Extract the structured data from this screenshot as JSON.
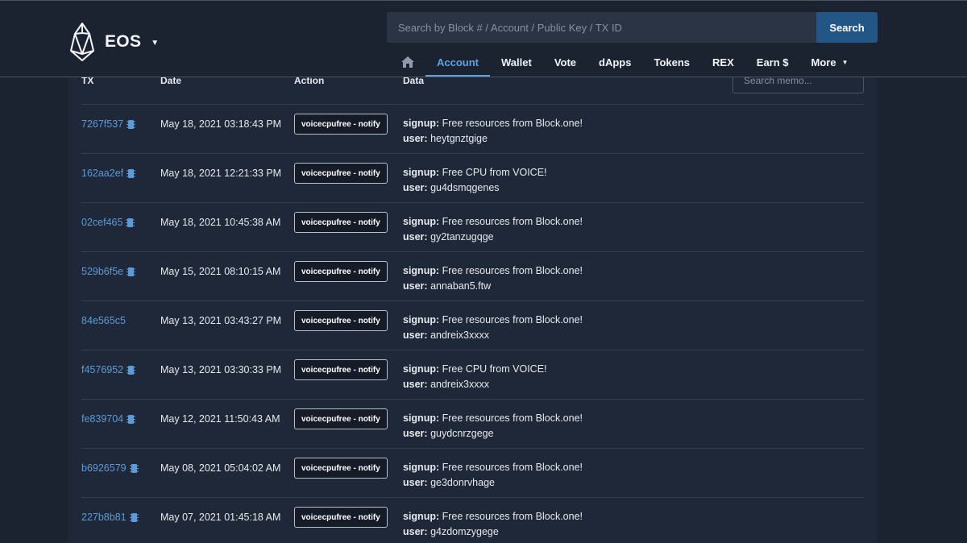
{
  "header": {
    "brand": "EOS",
    "search_placeholder": "Search by Block # / Account / Public Key / TX ID",
    "search_button": "Search",
    "nav": [
      {
        "label": "Account",
        "active": true
      },
      {
        "label": "Wallet"
      },
      {
        "label": "Vote"
      },
      {
        "label": "dApps"
      },
      {
        "label": "Tokens"
      },
      {
        "label": "REX"
      },
      {
        "label": "Earn $"
      },
      {
        "label": "More"
      }
    ]
  },
  "table": {
    "columns": {
      "tx": "TX",
      "date": "Date",
      "action": "Action",
      "data": "Data"
    },
    "memo_placeholder": "Search memo...",
    "rows": [
      {
        "tx": "7267f537",
        "chip": true,
        "date": "May 18, 2021 03:18:43 PM",
        "action": "voicecpufree - notify",
        "signup_key": "signup:",
        "signup": "Free resources from Block.one!",
        "user_key": "user:",
        "user": "heytgnztgige"
      },
      {
        "tx": "162aa2ef",
        "chip": true,
        "date": "May 18, 2021 12:21:33 PM",
        "action": "voicecpufree - notify",
        "signup_key": "signup:",
        "signup": "Free CPU from VOICE!",
        "user_key": "user:",
        "user": "gu4dsmqgenes"
      },
      {
        "tx": "02cef465",
        "chip": true,
        "date": "May 18, 2021 10:45:38 AM",
        "action": "voicecpufree - notify",
        "signup_key": "signup:",
        "signup": "Free resources from Block.one!",
        "user_key": "user:",
        "user": "gy2tanzugqge"
      },
      {
        "tx": "529b6f5e",
        "chip": true,
        "date": "May 15, 2021 08:10:15 AM",
        "action": "voicecpufree - notify",
        "signup_key": "signup:",
        "signup": "Free resources from Block.one!",
        "user_key": "user:",
        "user": "annaban5.ftw"
      },
      {
        "tx": "84e565c5",
        "chip": false,
        "date": "May 13, 2021 03:43:27 PM",
        "action": "voicecpufree - notify",
        "signup_key": "signup:",
        "signup": "Free resources from Block.one!",
        "user_key": "user:",
        "user": "andreix3xxxx"
      },
      {
        "tx": "f4576952",
        "chip": true,
        "date": "May 13, 2021 03:30:33 PM",
        "action": "voicecpufree - notify",
        "signup_key": "signup:",
        "signup": "Free CPU from VOICE!",
        "user_key": "user:",
        "user": "andreix3xxxx"
      },
      {
        "tx": "fe839704",
        "chip": true,
        "date": "May 12, 2021 11:50:43 AM",
        "action": "voicecpufree - notify",
        "signup_key": "signup:",
        "signup": "Free resources from Block.one!",
        "user_key": "user:",
        "user": "guydcnrzgege"
      },
      {
        "tx": "b6926579",
        "chip": true,
        "date": "May 08, 2021 05:04:02 AM",
        "action": "voicecpufree - notify",
        "signup_key": "signup:",
        "signup": "Free resources from Block.one!",
        "user_key": "user:",
        "user": "ge3donrvhage"
      },
      {
        "tx": "227b8b81",
        "chip": true,
        "date": "May 07, 2021 01:45:18 AM",
        "action": "voicecpufree - notify",
        "signup_key": "signup:",
        "signup": "Free resources from Block.one!",
        "user_key": "user:",
        "user": "g4zdomzygege"
      }
    ]
  },
  "colors": {
    "background": "#1b2331",
    "panel": "#1f2838",
    "link": "#5c9bd6",
    "accent": "#5ea2e3",
    "search_button": "#225686"
  },
  "icons": {
    "brand": "eos-logo-icon",
    "home": "home-icon",
    "chip": "cpu-chip-icon",
    "dropdown": "chevron-down-icon"
  }
}
